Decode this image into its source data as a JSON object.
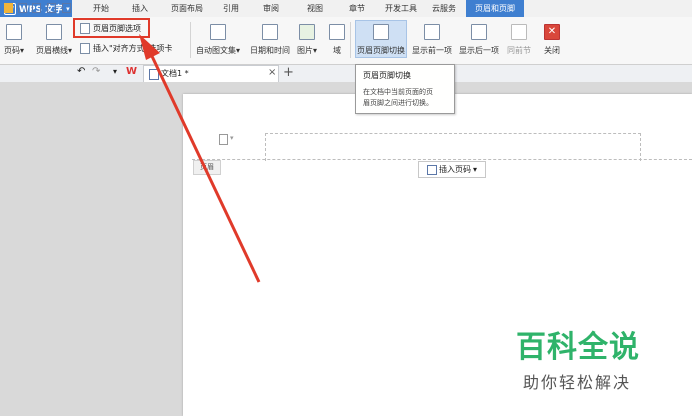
{
  "app": {
    "name": "WPS 文字",
    "logo": "W"
  },
  "menu_tabs": [
    {
      "label": "开始"
    },
    {
      "label": "插入"
    },
    {
      "label": "页面布局"
    },
    {
      "label": "引用"
    },
    {
      "label": "审阅"
    },
    {
      "label": "视图"
    },
    {
      "label": "章节"
    },
    {
      "label": "开发工具"
    },
    {
      "label": "云服务"
    },
    {
      "label": "页眉和页脚",
      "active": true
    }
  ],
  "ribbon": {
    "page_number": "页码",
    "header_line": "页眉横线",
    "header_footer_options": "页眉页脚选项",
    "insert_align_tab": "插入\"对齐方式\"选项卡",
    "auto_caption": "自动图文集",
    "date_time": "日期和时间",
    "picture": "图片",
    "field": "域",
    "switch_header_footer": "页眉页脚切换",
    "show_previous": "显示前一项",
    "show_next": "显示后一项",
    "same_as_previous": "同前节",
    "close": "关闭"
  },
  "document_tab": {
    "name": "文档1 *"
  },
  "tooltip": {
    "title": "页眉页脚切换",
    "desc_line1": "在文档中当前页面的页",
    "desc_line2": "眉页脚之间进行切换。"
  },
  "page": {
    "header_label": "页眉",
    "insert_page_number": "插入页码"
  },
  "watermark": {
    "title": "百科全说",
    "subtitle": "助你轻松解决"
  },
  "colors": {
    "accent": "#3f7fd0",
    "highlight": "#e03a2a",
    "watermark": "#2fb36a"
  },
  "icons": [
    "app-logo-icon",
    "page-number-icon",
    "header-line-icon",
    "options-icon",
    "caption-icon",
    "calendar-icon",
    "picture-icon",
    "field-icon",
    "switch-icon",
    "prev-icon",
    "next-icon",
    "same-prev-icon",
    "close-icon"
  ]
}
